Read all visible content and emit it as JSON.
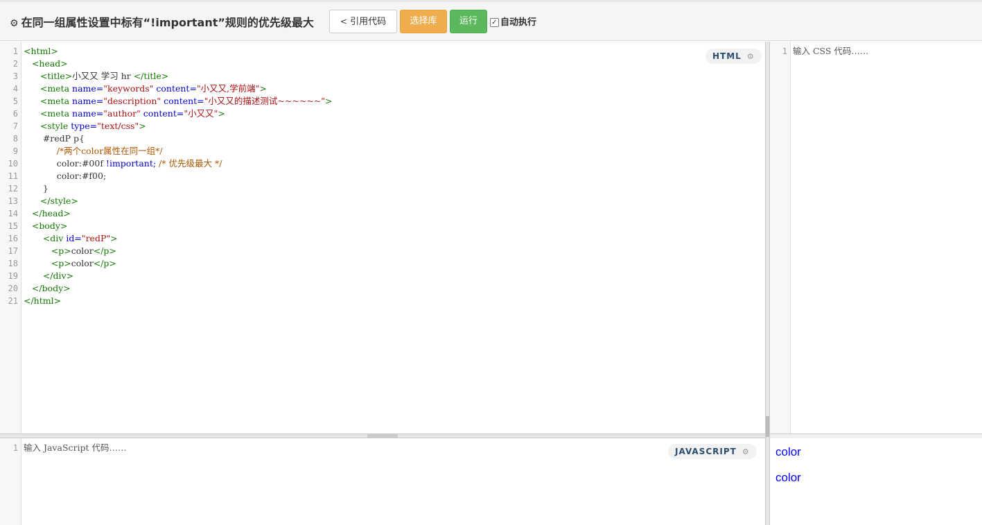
{
  "toolbar": {
    "title": "在同一组属性设置中标有“!important”规则的优先级最大",
    "share_label": "引用代码",
    "library_label": "选择库",
    "run_label": "运行",
    "auto_run_label": "自动执行",
    "auto_run_checked": true
  },
  "html_editor": {
    "badge": "HTML",
    "line_numbers": [
      "1",
      "2",
      "3",
      "4",
      "5",
      "6",
      "7",
      "8",
      "9",
      "10",
      "11",
      "12",
      "13",
      "14",
      "15",
      "16",
      "17",
      "18",
      "19",
      "20",
      "21"
    ]
  },
  "css_editor": {
    "line_numbers": [
      "1"
    ],
    "placeholder": "输入 CSS 代码……"
  },
  "js_editor": {
    "badge": "JAVASCRIPT",
    "line_numbers": [
      "1"
    ],
    "placeholder": "输入 JavaScript 代码……"
  },
  "result": {
    "paragraphs": [
      "color",
      "color"
    ],
    "text_color": "#0000ff"
  },
  "colors": {
    "run_button": "#5cb85c",
    "library_button": "#f0ad4e",
    "tag": "#117700",
    "attribute": "#0000cc",
    "string": "#aa1111",
    "comment": "#aa5500"
  },
  "icons": [
    "gears-icon",
    "share-icon",
    "checkbox-icon",
    "gear-icon"
  ],
  "code_tokens": {
    "l1": [
      "<html>"
    ],
    "l2": [
      "<head>"
    ],
    "l3": [
      "<title>",
      "小又又 学习 hr ",
      "</title>"
    ],
    "l4": [
      "<meta",
      " name=",
      "\"keywords\"",
      " content=",
      "\"小又又,学前端\"",
      ">"
    ],
    "l5": [
      "<meta",
      " name=",
      "\"description\"",
      " content=",
      "\"小又又的描述测试~~~~~~\"",
      ">"
    ],
    "l6": [
      "<meta",
      " name=",
      "\"author\"",
      " content=",
      "\"小又又\"",
      ">"
    ],
    "l7": [
      "<style",
      " type=",
      "\"text/css\"",
      ">"
    ],
    "l8": [
      "#redP p{"
    ],
    "l9": [
      "/*两个color属性在同一组*/"
    ],
    "l10": [
      "color:",
      "#00f",
      " !important;",
      " /* 优先级最大 */"
    ],
    "l11": [
      "color:",
      "#f00",
      ";"
    ],
    "l12": [
      "}"
    ],
    "l13": [
      "</style>"
    ],
    "l14": [
      "</head>"
    ],
    "l15": [
      "<body>"
    ],
    "l16": [
      "<div",
      " id=",
      "\"redP\"",
      ">"
    ],
    "l17": [
      "<p>",
      "color",
      "</p>"
    ],
    "l18": [
      "<p>",
      "color",
      "</p>"
    ],
    "l19": [
      "</div>"
    ],
    "l20": [
      "</body>"
    ],
    "l21": [
      "</html>"
    ]
  }
}
